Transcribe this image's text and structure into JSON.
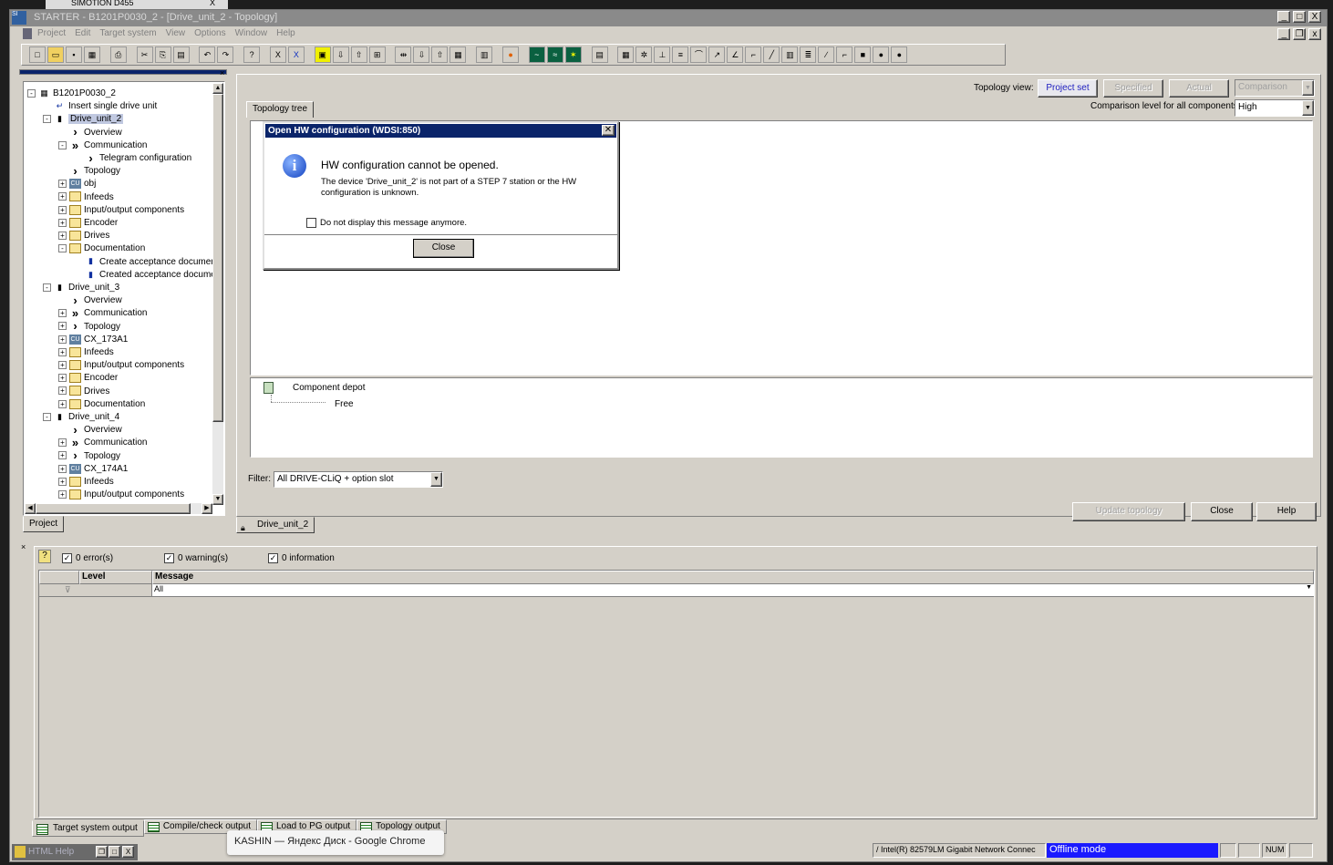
{
  "browser_tab": {
    "label": "SIMOTION D455",
    "close": "X"
  },
  "window": {
    "title": "STARTER - B1201P0030_2 - [Drive_unit_2 - Topology]",
    "controls": [
      "_",
      "□",
      "X"
    ]
  },
  "menu": [
    "Project",
    "Edit",
    "Target system",
    "View",
    "Options",
    "Window",
    "Help"
  ],
  "tree": [
    {
      "level": 0,
      "exp": "-",
      "icon": "project",
      "label": "B1201P0030_2"
    },
    {
      "level": 1,
      "exp": "",
      "icon": "insert",
      "label": "Insert single drive unit"
    },
    {
      "level": 1,
      "exp": "-",
      "icon": "drive",
      "label": "Drive_unit_2",
      "selected": true
    },
    {
      "level": 2,
      "exp": "",
      "icon": "chevron",
      "label": "Overview"
    },
    {
      "level": 2,
      "exp": "-",
      "icon": "dchevron",
      "label": "Communication"
    },
    {
      "level": 3,
      "exp": "",
      "icon": "chevron",
      "label": "Telegram configuration"
    },
    {
      "level": 2,
      "exp": "",
      "icon": "chevron",
      "label": "Topology"
    },
    {
      "level": 2,
      "exp": "+",
      "icon": "cu",
      "label": "obj"
    },
    {
      "level": 2,
      "exp": "+",
      "icon": "folder",
      "label": "Infeeds"
    },
    {
      "level": 2,
      "exp": "+",
      "icon": "folder",
      "label": "Input/output components"
    },
    {
      "level": 2,
      "exp": "+",
      "icon": "folder",
      "label": "Encoder"
    },
    {
      "level": 2,
      "exp": "+",
      "icon": "folder",
      "label": "Drives"
    },
    {
      "level": 2,
      "exp": "-",
      "icon": "folder",
      "label": "Documentation"
    },
    {
      "level": 3,
      "exp": "",
      "icon": "doc",
      "label": "Create acceptance documer"
    },
    {
      "level": 3,
      "exp": "",
      "icon": "doc",
      "label": "Created acceptance docume"
    },
    {
      "level": 1,
      "exp": "-",
      "icon": "drive",
      "label": "Drive_unit_3"
    },
    {
      "level": 2,
      "exp": "",
      "icon": "chevron",
      "label": "Overview"
    },
    {
      "level": 2,
      "exp": "+",
      "icon": "dchevron",
      "label": "Communication"
    },
    {
      "level": 2,
      "exp": "+",
      "icon": "chevron",
      "label": "Topology"
    },
    {
      "level": 2,
      "exp": "+",
      "icon": "cu",
      "label": "CX_173A1"
    },
    {
      "level": 2,
      "exp": "+",
      "icon": "folder",
      "label": "Infeeds"
    },
    {
      "level": 2,
      "exp": "+",
      "icon": "folder",
      "label": "Input/output components"
    },
    {
      "level": 2,
      "exp": "+",
      "icon": "folder",
      "label": "Encoder"
    },
    {
      "level": 2,
      "exp": "+",
      "icon": "folder",
      "label": "Drives"
    },
    {
      "level": 2,
      "exp": "+",
      "icon": "folder",
      "label": "Documentation"
    },
    {
      "level": 1,
      "exp": "-",
      "icon": "drive",
      "label": "Drive_unit_4"
    },
    {
      "level": 2,
      "exp": "",
      "icon": "chevron",
      "label": "Overview"
    },
    {
      "level": 2,
      "exp": "+",
      "icon": "dchevron",
      "label": "Communication"
    },
    {
      "level": 2,
      "exp": "+",
      "icon": "chevron",
      "label": "Topology"
    },
    {
      "level": 2,
      "exp": "+",
      "icon": "cu",
      "label": "CX_174A1"
    },
    {
      "level": 2,
      "exp": "+",
      "icon": "folder",
      "label": "Infeeds"
    },
    {
      "level": 2,
      "exp": "+",
      "icon": "folder",
      "label": "Input/output components"
    }
  ],
  "project_tab": "Project",
  "topology": {
    "view_label": "Topology view:",
    "views": [
      "Project set",
      "Specified",
      "Actual"
    ],
    "comparison_select": "Comparison",
    "comparison_level_label": "Comparison level for all components:",
    "comparison_level": "High",
    "tree_tab": "Topology tree",
    "depot_label": "Component depot",
    "depot_free": "Free",
    "filter_label": "Filter:",
    "filter_value": "All DRIVE-CLiQ + option slot",
    "update_button": "Update topology",
    "close_button": "Close",
    "help_button": "Help",
    "doc_tab": "Drive_unit_2"
  },
  "dialog": {
    "title": "Open HW configuration  (WDSI:850)",
    "heading": "HW configuration cannot be opened.",
    "message": "The device 'Drive_unit_2' is not part of a STEP 7 station or the HW configuration is unknown.",
    "checkbox_label": "Do not display this message anymore.",
    "checked": false,
    "close_button": "Close"
  },
  "output": {
    "errors": "0 error(s)",
    "warnings": "0 warning(s)",
    "information": "0 information",
    "columns": [
      "Level",
      "Message"
    ],
    "message_filter": "All",
    "tabs": [
      "Target system output",
      "Compile/check output",
      "Load to PG output",
      "Topology output"
    ]
  },
  "taskbar": {
    "html_help": "HTML Help",
    "tooltip": "KASHIN — Яндекс Диск - Google Chrome"
  },
  "status": {
    "adapter": "/ Intel(R) 82579LM Gigabit Network Connec",
    "mode": "Offline mode",
    "num": "NUM"
  },
  "colors": {
    "offline_mode": "#1a1aff",
    "dialog_title": "#0a246a",
    "selection": "#c0c8e0"
  }
}
